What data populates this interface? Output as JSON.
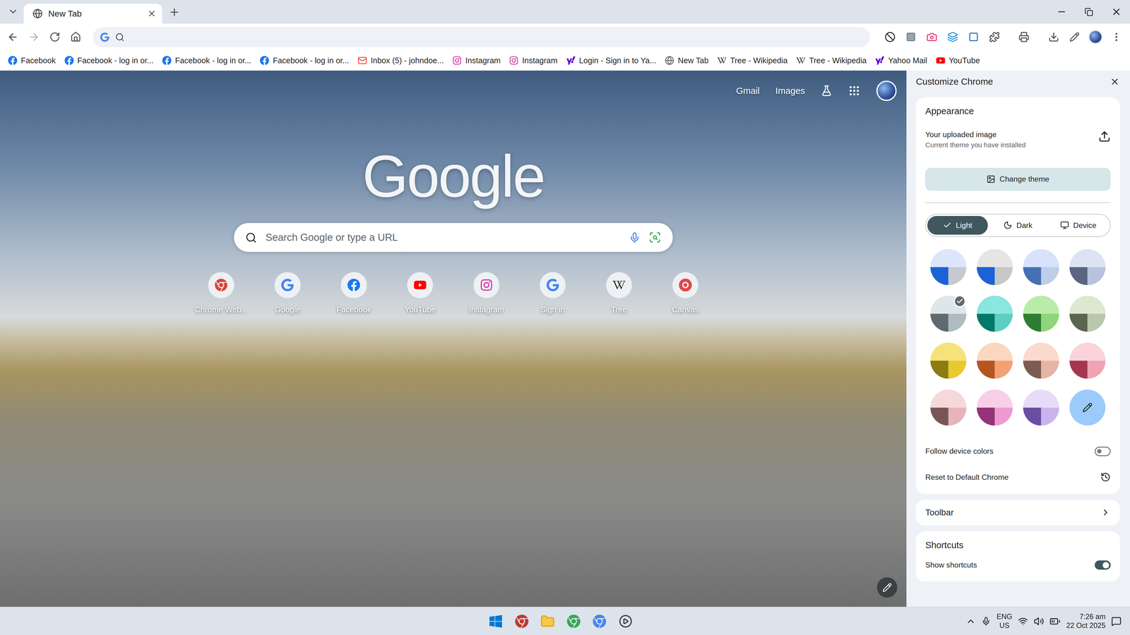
{
  "window": {
    "title": "New Tab"
  },
  "tabs": [
    {
      "label": "New Tab",
      "selected": true
    }
  ],
  "bookmarks": [
    {
      "label": "Facebook",
      "kind": "facebook"
    },
    {
      "label": "Facebook - log in or...",
      "kind": "facebook"
    },
    {
      "label": "Facebook - log in or...",
      "kind": "facebook"
    },
    {
      "label": "Facebook - log in or...",
      "kind": "facebook"
    },
    {
      "label": "Inbox (5) - johndoe...",
      "kind": "gmail"
    },
    {
      "label": "Instagram",
      "kind": "instagram"
    },
    {
      "label": "Instagram",
      "kind": "instagram"
    },
    {
      "label": "Login - Sign in to Ya...",
      "kind": "yahoo"
    },
    {
      "label": "New Tab",
      "kind": "globe"
    },
    {
      "label": "Tree - Wikipedia",
      "kind": "wikipedia"
    },
    {
      "label": "Tree - Wikipedia",
      "kind": "wikipedia"
    },
    {
      "label": "Yahoo Mail",
      "kind": "yahoo"
    },
    {
      "label": "YouTube",
      "kind": "youtube"
    }
  ],
  "ntp": {
    "links": [
      "Gmail",
      "Images"
    ],
    "logo": "Google",
    "search": {
      "placeholder": "Search Google or type a URL"
    },
    "shortcuts": [
      {
        "label": "Chrome Web...",
        "kind": "webstore"
      },
      {
        "label": "Google",
        "kind": "google"
      },
      {
        "label": "Facebook",
        "kind": "facebook"
      },
      {
        "label": "YouTube",
        "kind": "youtube"
      },
      {
        "label": "Instagram",
        "kind": "instagram"
      },
      {
        "label": "Sign in",
        "kind": "google"
      },
      {
        "label": "Tree",
        "kind": "wikipedia"
      },
      {
        "label": "Canvas",
        "kind": "canva"
      }
    ]
  },
  "panel": {
    "title": "Customize Chrome",
    "appearance": {
      "heading": "Appearance",
      "theme_title": "Your uploaded image",
      "theme_sub": "Current theme you have installed",
      "change": "Change theme",
      "modes": [
        {
          "label": "Light",
          "selected": true,
          "kind": "light"
        },
        {
          "label": "Dark",
          "selected": false,
          "kind": "dark"
        },
        {
          "label": "Device",
          "selected": false,
          "kind": "device"
        }
      ],
      "swatches": [
        {
          "kind": "preset",
          "tint": "#dbe6fb",
          "color": "#1a62d6",
          "accent": "#c7c9ce",
          "selected": false
        },
        {
          "kind": "preset",
          "tint": "#e5e5e5",
          "color": "#1a62d6",
          "accent": "#c7c7c7",
          "selected": false
        },
        {
          "kind": "preset",
          "tint": "#d7e3fb",
          "color": "#4670b4",
          "accent": "#c0cde6",
          "selected": false
        },
        {
          "kind": "preset",
          "tint": "#dde3f2",
          "color": "#5a6580",
          "accent": "#b9c2dc",
          "selected": false
        },
        {
          "kind": "preset",
          "tint": "#dde6e8",
          "color": "#5f6a6e",
          "accent": "#aebbbf",
          "selected": true
        },
        {
          "kind": "preset",
          "tint": "#8ae6df",
          "color": "#00796b",
          "accent": "#5ecdc2",
          "selected": false
        },
        {
          "kind": "preset",
          "tint": "#b9eca8",
          "color": "#2e7d32",
          "accent": "#8fd47b",
          "selected": false
        },
        {
          "kind": "preset",
          "tint": "#dde8d3",
          "color": "#5a6651",
          "accent": "#b9c7ad",
          "selected": false
        },
        {
          "kind": "preset",
          "tint": "#f7e17a",
          "color": "#8d7a10",
          "accent": "#e9c930",
          "selected": false
        },
        {
          "kind": "preset",
          "tint": "#fbd7c0",
          "color": "#b4561e",
          "accent": "#f3a173",
          "selected": false
        },
        {
          "kind": "preset",
          "tint": "#fbd9cc",
          "color": "#7b5c52",
          "accent": "#e7b5a4",
          "selected": false
        },
        {
          "kind": "preset",
          "tint": "#fbd3db",
          "color": "#a3374f",
          "accent": "#f2a3b3",
          "selected": false
        },
        {
          "kind": "preset",
          "tint": "#f6d7da",
          "color": "#7a5558",
          "accent": "#e6b4b9",
          "selected": false
        },
        {
          "kind": "preset",
          "tint": "#f8cfe6",
          "color": "#94337a",
          "accent": "#ec9ad0",
          "selected": false
        },
        {
          "kind": "preset",
          "tint": "#e7dcf7",
          "color": "#6b4ea3",
          "accent": "#c9b5ec",
          "selected": false
        },
        {
          "kind": "custom",
          "tint": "#9ccafa",
          "color": "#9ccafa",
          "accent": "#9ccafa",
          "selected": false
        }
      ],
      "follow": {
        "label": "Follow device colors",
        "on": false
      },
      "reset": "Reset to Default Chrome"
    },
    "toolbar": "Toolbar",
    "shortcuts": {
      "heading": "Shortcuts",
      "show": {
        "label": "Show shortcuts",
        "on": true
      }
    }
  },
  "taskbar": {
    "lang": [
      "ENG",
      "US"
    ],
    "time": "7:26 am",
    "date": "22 Oct 2025"
  }
}
